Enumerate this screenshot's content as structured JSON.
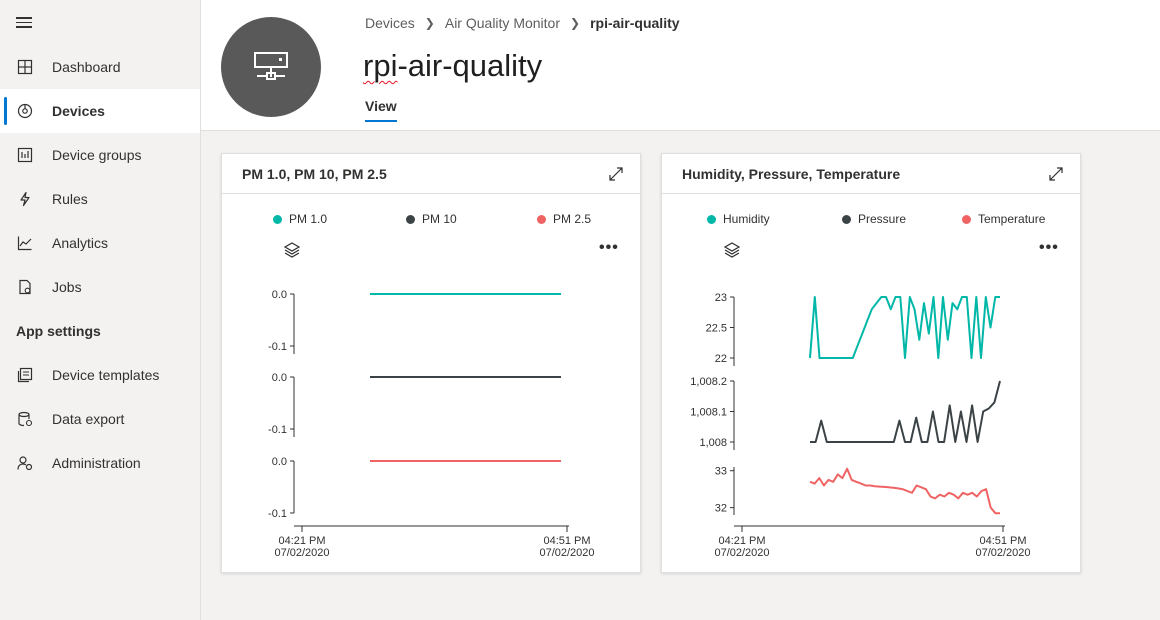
{
  "sidebar": {
    "items": [
      {
        "label": "Dashboard",
        "icon": "dashboard-icon"
      },
      {
        "label": "Devices",
        "icon": "devices-icon",
        "active": true
      },
      {
        "label": "Device groups",
        "icon": "device-groups-icon"
      },
      {
        "label": "Rules",
        "icon": "rules-icon"
      },
      {
        "label": "Analytics",
        "icon": "analytics-icon"
      },
      {
        "label": "Jobs",
        "icon": "jobs-icon"
      }
    ],
    "section_title": "App settings",
    "settings_items": [
      {
        "label": "Device templates",
        "icon": "device-templates-icon"
      },
      {
        "label": "Data export",
        "icon": "data-export-icon"
      },
      {
        "label": "Administration",
        "icon": "administration-icon"
      }
    ]
  },
  "header": {
    "breadcrumb": [
      "Devices",
      "Air Quality Monitor",
      "rpi-air-quality"
    ],
    "title": "rpi-air-quality",
    "tab": "View"
  },
  "colors": {
    "teal": "#00b7a8",
    "dark": "#3b4346",
    "red": "#ef6363",
    "accent": "#0078d4"
  },
  "chart_data": [
    {
      "type": "line",
      "title": "PM 1.0, PM 10, PM 2.5",
      "legend": [
        "PM 1.0",
        "PM 10",
        "PM 2.5"
      ],
      "x_ticks": [
        {
          "time": "04:21 PM",
          "date": "07/02/2020"
        },
        {
          "time": "04:51 PM",
          "date": "07/02/2020"
        }
      ],
      "layout": "stacked",
      "series": [
        {
          "name": "PM 1.0",
          "color": "#00b7a8",
          "y_ticks": [
            "0.0",
            "-0.1"
          ],
          "ylim": [
            -0.1,
            0.0
          ],
          "x_start": "04:31 PM",
          "x_end": "04:51 PM",
          "values": [
            0.0,
            0.0
          ]
        },
        {
          "name": "PM 10",
          "color": "#3b4346",
          "y_ticks": [
            "0.0",
            "-0.1"
          ],
          "ylim": [
            -0.1,
            0.0
          ],
          "x_start": "04:31 PM",
          "x_end": "04:51 PM",
          "values": [
            0.0,
            0.0
          ]
        },
        {
          "name": "PM 2.5",
          "color": "#ef6363",
          "y_ticks": [
            "0.0",
            "-0.1"
          ],
          "ylim": [
            -0.1,
            0.0
          ],
          "x_start": "04:31 PM",
          "x_end": "04:51 PM",
          "values": [
            0.0,
            0.0
          ]
        }
      ]
    },
    {
      "type": "line",
      "title": "Humidity, Pressure, Temperature",
      "legend": [
        "Humidity",
        "Pressure",
        "Temperature"
      ],
      "x_ticks": [
        {
          "time": "04:21 PM",
          "date": "07/02/2020"
        },
        {
          "time": "04:51 PM",
          "date": "07/02/2020"
        }
      ],
      "layout": "stacked",
      "series": [
        {
          "name": "Humidity",
          "color": "#00b7a8",
          "y_ticks": [
            "23",
            "22.5",
            "22"
          ],
          "ylim": [
            22,
            23
          ],
          "values": [
            22,
            23,
            22,
            22,
            22,
            22,
            22,
            22,
            22,
            22,
            22.2,
            22.4,
            22.6,
            22.8,
            22.9,
            23,
            23,
            22.8,
            23,
            23,
            22,
            23,
            22.8,
            22.3,
            22.9,
            22.4,
            23,
            22,
            23,
            22.3,
            22.9,
            22.8,
            23,
            23,
            22,
            23,
            22,
            23,
            22.5,
            23,
            23
          ]
        },
        {
          "name": "Pressure",
          "color": "#3b4346",
          "y_ticks": [
            "1,008.2",
            "1,008.1",
            "1,008"
          ],
          "ylim": [
            1008,
            1008.2
          ],
          "values": [
            1008,
            1008,
            1008.07,
            1008,
            1008,
            1008,
            1008,
            1008,
            1008,
            1008,
            1008,
            1008,
            1008,
            1008,
            1008,
            1008,
            1008.07,
            1008,
            1008,
            1008.08,
            1008,
            1008,
            1008.1,
            1008,
            1008,
            1008.12,
            1008,
            1008.1,
            1008,
            1008.12,
            1008,
            1008.1,
            1008.11,
            1008.13,
            1008.2
          ]
        },
        {
          "name": "Temperature",
          "color": "#ef6363",
          "y_ticks": [
            "33",
            "32"
          ],
          "ylim": [
            31.8,
            33.1
          ],
          "values": [
            32.7,
            32.65,
            32.8,
            32.6,
            32.75,
            32.7,
            32.9,
            32.8,
            33.05,
            32.75,
            32.7,
            32.65,
            32.6,
            32.6,
            32.58,
            32.57,
            32.56,
            32.55,
            32.54,
            32.52,
            32.5,
            32.45,
            32.4,
            32.6,
            32.55,
            32.5,
            32.3,
            32.25,
            32.35,
            32.3,
            32.4,
            32.35,
            32.25,
            32.4,
            32.35,
            32.4,
            32.3,
            32.45,
            32.5,
            32.0,
            31.85,
            31.85
          ]
        }
      ]
    }
  ]
}
